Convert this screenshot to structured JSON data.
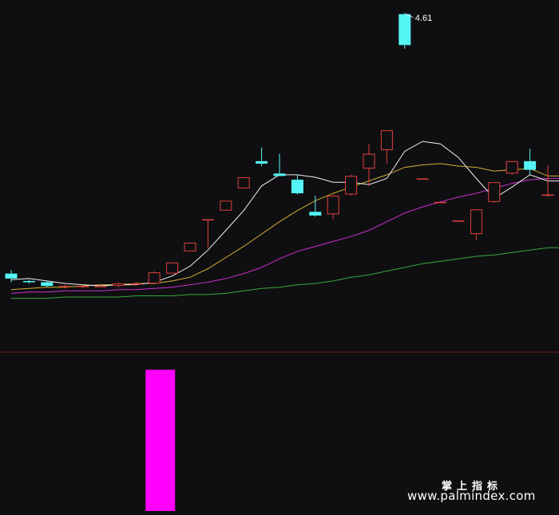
{
  "chart_data": [
    {
      "type": "candlestick",
      "title": "",
      "peak_label": "4.61",
      "ylim": [
        2.0,
        4.65
      ],
      "colors": {
        "up": "#e0403a",
        "down": "#55f5f5",
        "ma5": "#f2f2f2",
        "ma10": "#d4b030",
        "ma20": "#cc2fcc",
        "ma60": "#3aa83a"
      },
      "candles": [
        {
          "o": 2.5,
          "h": 2.53,
          "l": 2.43,
          "c": 2.46
        },
        {
          "o": 2.44,
          "h": 2.45,
          "l": 2.42,
          "c": 2.43
        },
        {
          "o": 2.43,
          "h": 2.44,
          "l": 2.39,
          "c": 2.4
        },
        {
          "o": 2.4,
          "h": 2.41,
          "l": 2.38,
          "c": 2.4
        },
        {
          "o": 2.39,
          "h": 2.4,
          "l": 2.38,
          "c": 2.4
        },
        {
          "o": 2.4,
          "h": 2.41,
          "l": 2.39,
          "c": 2.4
        },
        {
          "o": 2.4,
          "h": 2.43,
          "l": 2.39,
          "c": 2.42
        },
        {
          "o": 2.42,
          "h": 2.43,
          "l": 2.41,
          "c": 2.42
        },
        {
          "o": 2.42,
          "h": 2.52,
          "l": 2.42,
          "c": 2.51
        },
        {
          "o": 2.5,
          "h": 2.59,
          "l": 2.5,
          "c": 2.59
        },
        {
          "o": 2.68,
          "h": 2.75,
          "l": 2.68,
          "c": 2.75
        },
        {
          "o": 2.94,
          "h": 2.94,
          "l": 2.71,
          "c": 2.94
        },
        {
          "o": 3.01,
          "h": 3.09,
          "l": 3.01,
          "c": 3.09
        },
        {
          "o": 3.19,
          "h": 3.28,
          "l": 3.19,
          "c": 3.28
        },
        {
          "o": 3.41,
          "h": 3.52,
          "l": 3.37,
          "c": 3.39
        },
        {
          "o": 3.31,
          "h": 3.47,
          "l": 3.3,
          "c": 3.29
        },
        {
          "o": 3.26,
          "h": 3.3,
          "l": 3.14,
          "c": 3.15
        },
        {
          "o": 3.0,
          "h": 3.13,
          "l": 2.96,
          "c": 2.97
        },
        {
          "o": 2.98,
          "h": 3.14,
          "l": 2.94,
          "c": 3.13
        },
        {
          "o": 3.14,
          "h": 3.3,
          "l": 3.13,
          "c": 3.29
        },
        {
          "o": 3.35,
          "h": 3.55,
          "l": 3.21,
          "c": 3.47
        },
        {
          "o": 3.5,
          "h": 3.66,
          "l": 3.39,
          "c": 3.66
        },
        {
          "o": 4.6,
          "h": 4.61,
          "l": 4.32,
          "c": 4.35
        },
        {
          "o": 3.27,
          "h": 3.27,
          "l": 3.27,
          "c": 3.27
        },
        {
          "o": 3.08,
          "h": 3.08,
          "l": 3.08,
          "c": 3.08
        },
        {
          "o": 2.93,
          "h": 2.93,
          "l": 2.93,
          "c": 2.93
        },
        {
          "o": 2.82,
          "h": 3.02,
          "l": 2.77,
          "c": 3.02
        },
        {
          "o": 3.08,
          "h": 3.24,
          "l": 3.07,
          "c": 3.24
        },
        {
          "o": 3.31,
          "h": 3.41,
          "l": 3.3,
          "c": 3.41
        },
        {
          "o": 3.41,
          "h": 3.51,
          "l": 3.3,
          "c": 3.34
        },
        {
          "o": 3.13,
          "h": 3.38,
          "l": 3.12,
          "c": 3.14
        }
      ],
      "ma5": [
        2.45,
        2.46,
        2.44,
        2.42,
        2.41,
        2.4,
        2.41,
        2.41,
        2.43,
        2.48,
        2.56,
        2.69,
        2.85,
        3.01,
        3.21,
        3.3,
        3.3,
        3.28,
        3.24,
        3.24,
        3.22,
        3.27,
        3.49,
        3.57,
        3.55,
        3.44,
        3.27,
        3.11,
        3.2,
        3.3,
        3.25
      ],
      "ma10": [
        2.37,
        2.38,
        2.39,
        2.39,
        2.4,
        2.41,
        2.41,
        2.42,
        2.42,
        2.44,
        2.47,
        2.54,
        2.63,
        2.72,
        2.82,
        2.92,
        3.01,
        3.09,
        3.15,
        3.2,
        3.25,
        3.3,
        3.36,
        3.38,
        3.39,
        3.37,
        3.36,
        3.33,
        3.34,
        3.35,
        3.29
      ],
      "ma20": [
        2.34,
        2.35,
        2.35,
        2.36,
        2.36,
        2.36,
        2.37,
        2.37,
        2.38,
        2.39,
        2.41,
        2.43,
        2.46,
        2.5,
        2.55,
        2.62,
        2.68,
        2.72,
        2.76,
        2.8,
        2.85,
        2.92,
        2.99,
        3.04,
        3.08,
        3.12,
        3.15,
        3.19,
        3.23,
        3.26,
        3.27
      ],
      "ma60": [
        2.3,
        2.3,
        2.3,
        2.31,
        2.31,
        2.31,
        2.31,
        2.32,
        2.32,
        2.32,
        2.33,
        2.33,
        2.34,
        2.36,
        2.38,
        2.39,
        2.41,
        2.42,
        2.44,
        2.47,
        2.49,
        2.52,
        2.55,
        2.58,
        2.6,
        2.62,
        2.64,
        2.65,
        2.67,
        2.69,
        2.71
      ]
    },
    {
      "type": "bar",
      "title": "",
      "ylim": [
        0,
        1
      ],
      "values": [
        0,
        0,
        0,
        0,
        0,
        0,
        0,
        1,
        0,
        0,
        0,
        0,
        0,
        0,
        0,
        0,
        0,
        0,
        0,
        0,
        0,
        0,
        0,
        0,
        0,
        0,
        0,
        0,
        0,
        0,
        0
      ],
      "color": "#ff00ff"
    }
  ],
  "watermark": {
    "cn": "掌上指标",
    "url": "www.palmindex.com"
  }
}
